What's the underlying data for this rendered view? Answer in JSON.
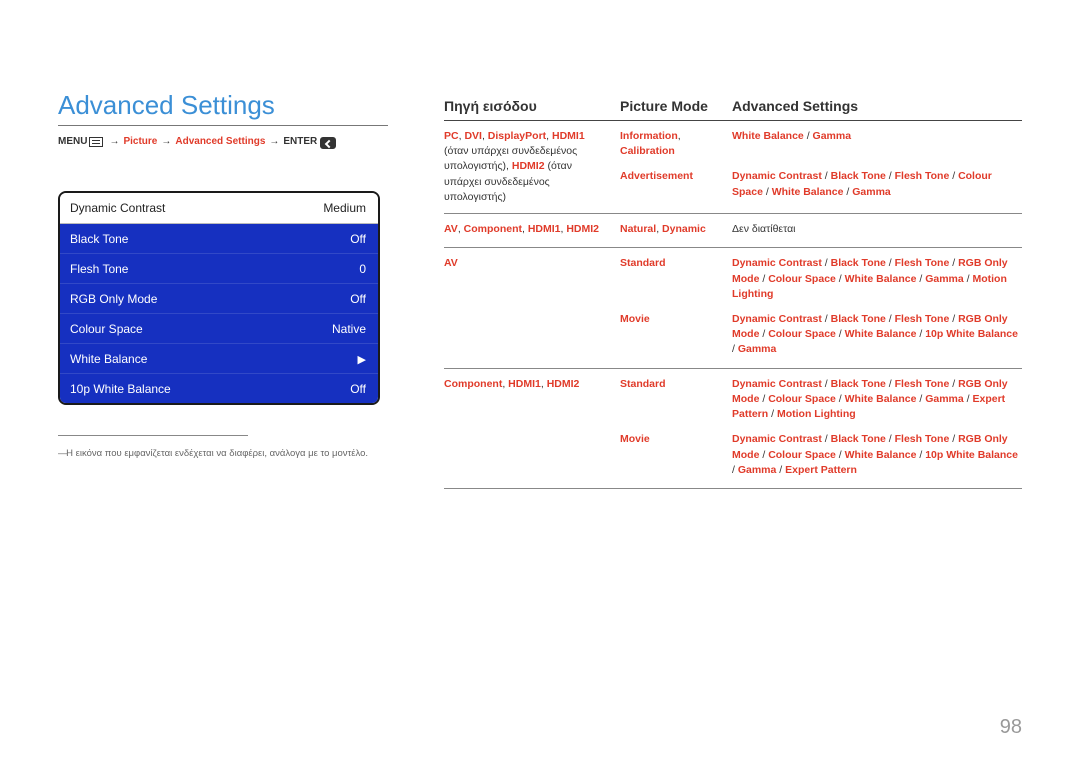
{
  "page_number": "98",
  "title": "Advanced Settings",
  "breadcrumb": {
    "menu": "MENU",
    "picture": "Picture",
    "adv": "Advanced Settings",
    "enter": "ENTER"
  },
  "osd": {
    "rows": [
      {
        "label": "Dynamic Contrast",
        "value": "Medium",
        "light": true
      },
      {
        "label": "Black Tone",
        "value": "Off",
        "light": false
      },
      {
        "label": "Flesh Tone",
        "value": "0",
        "light": false
      },
      {
        "label": "RGB Only Mode",
        "value": "Off",
        "light": false
      },
      {
        "label": "Colour Space",
        "value": "Native",
        "light": false
      },
      {
        "label": "White Balance",
        "value": "",
        "light": false,
        "arrow": true
      },
      {
        "label": "10p White Balance",
        "value": "Off",
        "light": false
      }
    ]
  },
  "footnote": "Η εικόνα που εμφανίζεται ενδέχεται να διαφέρει, ανάλογα με το μοντέλο.",
  "headers": {
    "c1": "Πηγή εισόδου",
    "c2": "Picture Mode",
    "c3": "Advanced Settings"
  },
  "groups": [
    {
      "src_parts": [
        {
          "t": "PC",
          "r": true
        },
        {
          "t": ", ",
          "r": false
        },
        {
          "t": "DVI",
          "r": true
        },
        {
          "t": ", ",
          "r": false
        },
        {
          "t": "DisplayPort",
          "r": true
        },
        {
          "t": ", ",
          "r": false
        },
        {
          "t": "HDMI1",
          "r": true
        },
        {
          "t": " (όταν υπάρχει συνδεδεμένος υπολογιστής), ",
          "r": false
        },
        {
          "t": "HDMI2",
          "r": true
        },
        {
          "t": " (όταν υπάρχει συνδεδεμένος υπολογιστής)",
          "r": false
        }
      ],
      "rows": [
        {
          "mode": [
            {
              "t": "Information",
              "r": true
            },
            {
              "t": ", ",
              "r": false
            },
            {
              "t": "Calibration",
              "r": true
            }
          ],
          "set": [
            {
              "t": "White Balance",
              "r": true
            },
            {
              "t": " / ",
              "r": false
            },
            {
              "t": "Gamma",
              "r": true
            }
          ]
        },
        {
          "mode": [
            {
              "t": "Advertisement",
              "r": true
            }
          ],
          "set": [
            {
              "t": "Dynamic Contrast",
              "r": true
            },
            {
              "t": " / ",
              "r": false
            },
            {
              "t": "Black Tone",
              "r": true
            },
            {
              "t": " / ",
              "r": false
            },
            {
              "t": "Flesh Tone",
              "r": true
            },
            {
              "t": " / ",
              "r": false
            },
            {
              "t": "Colour Space",
              "r": true
            },
            {
              "t": " / ",
              "r": false
            },
            {
              "t": "White Balance",
              "r": true
            },
            {
              "t": " / ",
              "r": false
            },
            {
              "t": "Gamma",
              "r": true
            }
          ]
        }
      ]
    },
    {
      "src_parts": [
        {
          "t": "AV",
          "r": true
        },
        {
          "t": ", ",
          "r": false
        },
        {
          "t": "Component",
          "r": true
        },
        {
          "t": ", ",
          "r": false
        },
        {
          "t": "HDMI1",
          "r": true
        },
        {
          "t": ", ",
          "r": false
        },
        {
          "t": "HDMI2",
          "r": true
        }
      ],
      "rows": [
        {
          "mode": [
            {
              "t": "Natural",
              "r": true
            },
            {
              "t": ", ",
              "r": false
            },
            {
              "t": "Dynamic",
              "r": true
            }
          ],
          "set": [
            {
              "t": "Δεν διατίθεται",
              "r": false
            }
          ]
        }
      ]
    },
    {
      "src_parts": [
        {
          "t": "AV",
          "r": true
        }
      ],
      "rows": [
        {
          "mode": [
            {
              "t": "Standard",
              "r": true
            }
          ],
          "set": [
            {
              "t": "Dynamic Contrast",
              "r": true
            },
            {
              "t": " / ",
              "r": false
            },
            {
              "t": "Black Tone",
              "r": true
            },
            {
              "t": " / ",
              "r": false
            },
            {
              "t": "Flesh Tone",
              "r": true
            },
            {
              "t": " / ",
              "r": false
            },
            {
              "t": "RGB Only Mode",
              "r": true
            },
            {
              "t": " / ",
              "r": false
            },
            {
              "t": "Colour Space",
              "r": true
            },
            {
              "t": " / ",
              "r": false
            },
            {
              "t": "White Balance",
              "r": true
            },
            {
              "t": " / ",
              "r": false
            },
            {
              "t": "Gamma",
              "r": true
            },
            {
              "t": " / ",
              "r": false
            },
            {
              "t": "Motion Lighting",
              "r": true
            }
          ]
        },
        {
          "mode": [
            {
              "t": "Movie",
              "r": true
            }
          ],
          "set": [
            {
              "t": "Dynamic Contrast",
              "r": true
            },
            {
              "t": " / ",
              "r": false
            },
            {
              "t": "Black Tone",
              "r": true
            },
            {
              "t": " / ",
              "r": false
            },
            {
              "t": "Flesh Tone",
              "r": true
            },
            {
              "t": " / ",
              "r": false
            },
            {
              "t": "RGB Only Mode",
              "r": true
            },
            {
              "t": " / ",
              "r": false
            },
            {
              "t": "Colour Space",
              "r": true
            },
            {
              "t": " / ",
              "r": false
            },
            {
              "t": "White Balance",
              "r": true
            },
            {
              "t": " / ",
              "r": false
            },
            {
              "t": "10p White Balance",
              "r": true
            },
            {
              "t": " / ",
              "r": false
            },
            {
              "t": "Gamma",
              "r": true
            }
          ]
        }
      ]
    },
    {
      "src_parts": [
        {
          "t": "Component",
          "r": true
        },
        {
          "t": ", ",
          "r": false
        },
        {
          "t": "HDMI1",
          "r": true
        },
        {
          "t": ", ",
          "r": false
        },
        {
          "t": "HDMI2",
          "r": true
        }
      ],
      "rows": [
        {
          "mode": [
            {
              "t": "Standard",
              "r": true
            }
          ],
          "set": [
            {
              "t": "Dynamic Contrast",
              "r": true
            },
            {
              "t": " / ",
              "r": false
            },
            {
              "t": "Black Tone",
              "r": true
            },
            {
              "t": " / ",
              "r": false
            },
            {
              "t": "Flesh Tone",
              "r": true
            },
            {
              "t": " / ",
              "r": false
            },
            {
              "t": "RGB Only Mode",
              "r": true
            },
            {
              "t": " / ",
              "r": false
            },
            {
              "t": "Colour Space",
              "r": true
            },
            {
              "t": " / ",
              "r": false
            },
            {
              "t": "White Balance",
              "r": true
            },
            {
              "t": " / ",
              "r": false
            },
            {
              "t": "Gamma",
              "r": true
            },
            {
              "t": " / ",
              "r": false
            },
            {
              "t": "Expert Pattern",
              "r": true
            },
            {
              "t": " / ",
              "r": false
            },
            {
              "t": "Motion Lighting",
              "r": true
            }
          ]
        },
        {
          "mode": [
            {
              "t": "Movie",
              "r": true
            }
          ],
          "set": [
            {
              "t": "Dynamic Contrast",
              "r": true
            },
            {
              "t": " / ",
              "r": false
            },
            {
              "t": "Black Tone",
              "r": true
            },
            {
              "t": " / ",
              "r": false
            },
            {
              "t": "Flesh Tone",
              "r": true
            },
            {
              "t": " / ",
              "r": false
            },
            {
              "t": "RGB Only Mode",
              "r": true
            },
            {
              "t": " / ",
              "r": false
            },
            {
              "t": "Colour Space",
              "r": true
            },
            {
              "t": " / ",
              "r": false
            },
            {
              "t": "White Balance",
              "r": true
            },
            {
              "t": " / ",
              "r": false
            },
            {
              "t": "10p White Balance",
              "r": true
            },
            {
              "t": " / ",
              "r": false
            },
            {
              "t": "Gamma",
              "r": true
            },
            {
              "t": " / ",
              "r": false
            },
            {
              "t": "Expert Pattern",
              "r": true
            }
          ]
        }
      ]
    }
  ]
}
